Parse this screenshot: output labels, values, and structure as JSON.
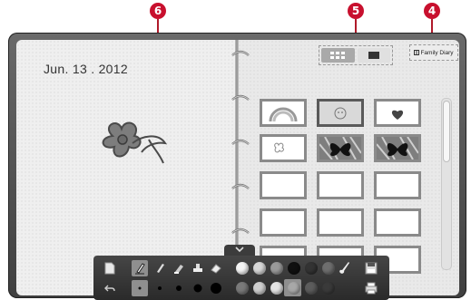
{
  "diary": {
    "date": "Jun. 13 . 2012"
  },
  "top_bar": {
    "family_diary_label": "Family Diary",
    "view_grid_icon": "grid-view-icon",
    "view_single_icon": "single-view-icon"
  },
  "callouts": [
    "6",
    "5",
    "4"
  ],
  "thumbnails": [
    {
      "content": "rainbow-drawing",
      "selected": false
    },
    {
      "content": "face-drawing",
      "selected": true
    },
    {
      "content": "heart-drawing",
      "selected": false
    },
    {
      "content": "flower-drawing",
      "selected": false
    },
    {
      "content": "butterfly-photo",
      "selected": false
    },
    {
      "content": "butterfly-photo",
      "selected": false
    },
    {
      "content": "empty",
      "selected": false
    },
    {
      "content": "empty",
      "selected": false
    },
    {
      "content": "empty",
      "selected": false
    },
    {
      "content": "empty",
      "selected": false
    },
    {
      "content": "empty",
      "selected": false
    },
    {
      "content": "empty",
      "selected": false
    },
    {
      "content": "empty",
      "selected": false
    },
    {
      "content": "empty",
      "selected": false
    },
    {
      "content": "empty",
      "selected": false
    }
  ],
  "toolbar": {
    "tools_row1": [
      "new-page-icon",
      "pen-tool-icon",
      "brush-tool-icon",
      "marker-tool-icon",
      "stamp-tool-icon",
      "eraser-tool-icon"
    ],
    "tools_row2": [
      "undo-icon",
      "size-1-icon",
      "size-2-icon",
      "size-3-icon",
      "size-4-icon",
      "size-5-icon"
    ],
    "colors_row1": [
      "#f4f4f4",
      "#d8d8d8",
      "#9a9a9a",
      "#101010",
      "#333333",
      "#6e6e6e"
    ],
    "colors_row2": [
      "#7a7a7a",
      "#cfcfcf",
      "#e3e3e3",
      "#a8a8a8",
      "#5c5c5c",
      "#3a3a3a"
    ],
    "save_icon": "save-icon",
    "print_icon": "print-icon"
  }
}
